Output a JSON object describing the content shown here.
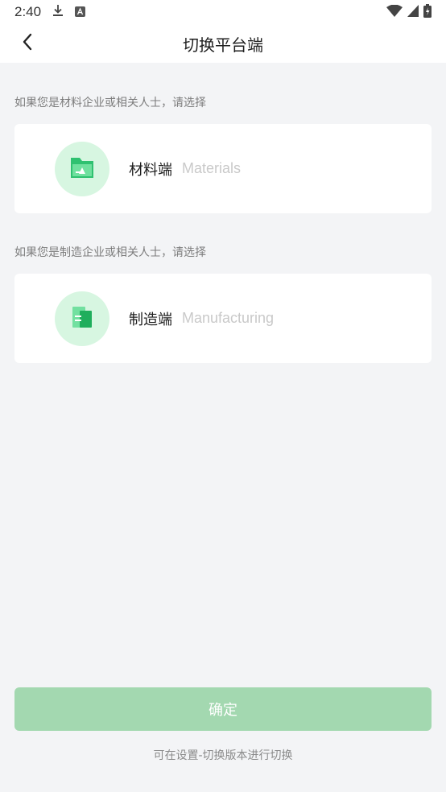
{
  "status_bar": {
    "time": "2:40",
    "icons": [
      "download-icon",
      "font-icon",
      "wifi-icon",
      "signal-icon",
      "battery-charging-icon"
    ]
  },
  "nav": {
    "back_icon": "chevron-left-icon",
    "title": "切换平台端"
  },
  "materials": {
    "hint": "如果您是材料企业或相关人士，请选择",
    "label": "材料端",
    "sublabel": "Materials",
    "icon": "folder-icon"
  },
  "manufacturing": {
    "hint": "如果您是制造企业或相关人士，请选择",
    "label": "制造端",
    "sublabel": "Manufacturing",
    "icon": "document-icon"
  },
  "confirm_label": "确定",
  "footer_note": "可在设置-切换版本进行切换",
  "colors": {
    "background": "#f3f4f6",
    "accent_green": "#2fc170",
    "button_disabled": "#a3d8b0",
    "icon_circle": "#d7f6e1"
  }
}
